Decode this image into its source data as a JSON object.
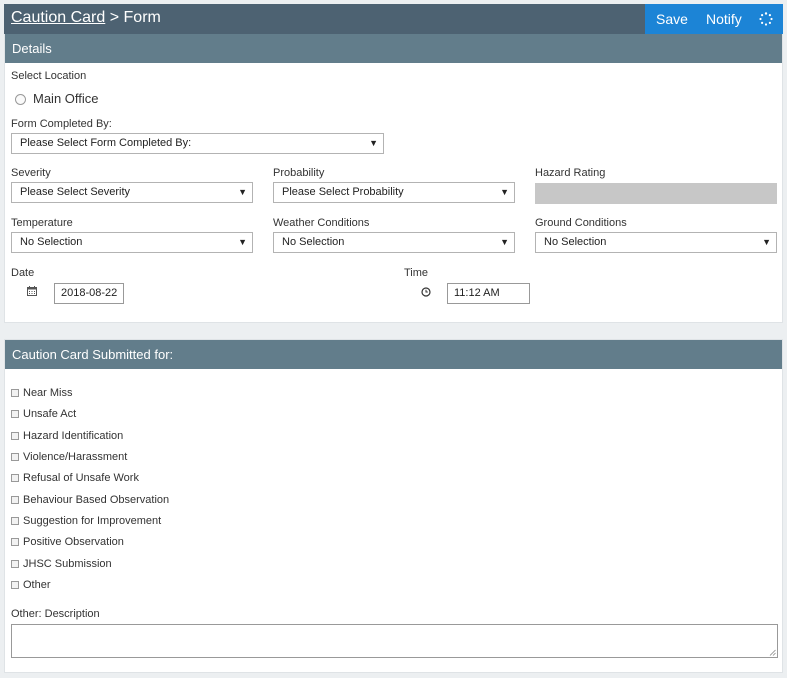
{
  "header": {
    "breadcrumb_parent": "Caution Card",
    "separator": ">",
    "current": "Form",
    "save_label": "Save",
    "notify_label": "Notify"
  },
  "details": {
    "title": "Details",
    "select_location_label": "Select Location",
    "location_option": "Main Office",
    "form_completed_by_label": "Form Completed By:",
    "form_completed_by_value": "Please Select Form Completed By:",
    "severity_label": "Severity",
    "severity_value": "Please Select Severity",
    "probability_label": "Probability",
    "probability_value": "Please Select Probability",
    "hazard_rating_label": "Hazard Rating",
    "temperature_label": "Temperature",
    "temperature_value": "No Selection",
    "weather_label": "Weather Conditions",
    "weather_value": "No Selection",
    "ground_label": "Ground Conditions",
    "ground_value": "No Selection",
    "date_label": "Date",
    "date_value": "2018-08-22",
    "time_label": "Time",
    "time_value": "11:12 AM"
  },
  "submitted": {
    "title": "Caution Card Submitted for:",
    "items": [
      "Near Miss",
      "Unsafe Act",
      "Hazard Identification",
      "Violence/Harassment",
      "Refusal of Unsafe Work",
      "Behaviour Based Observation",
      "Suggestion for Improvement",
      "Positive Observation",
      "JHSC Submission",
      "Other"
    ],
    "other_description_label": "Other: Description"
  },
  "colors": {
    "topbar": "#4d6272",
    "action_bar": "#1c84d6",
    "panel_header": "#627d8b",
    "readonly_field": "#c7c7c7"
  },
  "icons": {
    "calendar": "calendar-icon",
    "clock": "clock-icon",
    "spinner": "spinner-icon",
    "dropdown": "caret-down-icon"
  }
}
